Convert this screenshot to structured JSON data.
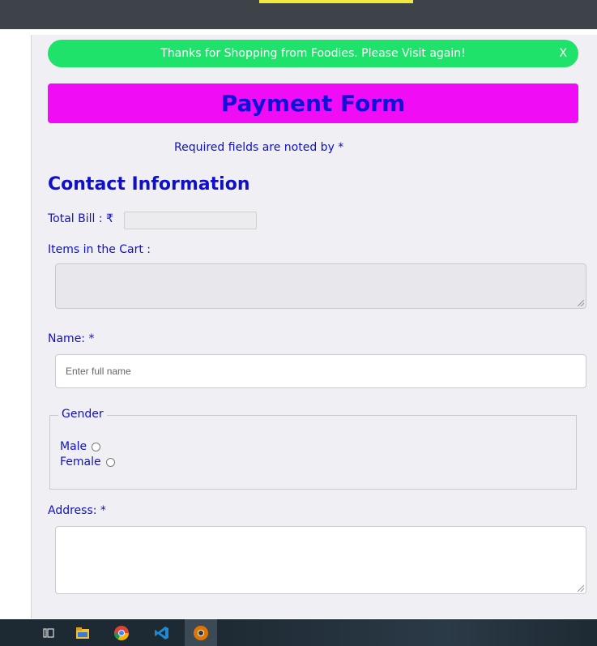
{
  "banner": {
    "message": "Thanks for Shopping from Foodies. Please Visit again!",
    "close_label": "X"
  },
  "form": {
    "title": "Payment Form",
    "required_note": "Required fields are noted by *",
    "section_title": "Contact Information",
    "total_bill_label": "Total Bill : ₹",
    "total_bill_value": "",
    "cart_label": "Items in the Cart :",
    "cart_value": "",
    "name_label": "Name: *",
    "name_placeholder": "Enter full name",
    "gender": {
      "legend": "Gender",
      "options": [
        {
          "label": "Male"
        },
        {
          "label": "Female"
        }
      ]
    },
    "address_label": "Address: *",
    "address_value": ""
  },
  "colors": {
    "banner_green": "#1fe26a",
    "title_magenta": "#f00cf4",
    "text_blue": "#1010c8",
    "topbar": "#3d4349",
    "taskbar": "#1e2a33"
  },
  "taskbar": {
    "icons": [
      "task-view-icon",
      "file-explorer-icon",
      "chrome-icon",
      "vscode-icon",
      "chrome-canary-icon"
    ]
  }
}
